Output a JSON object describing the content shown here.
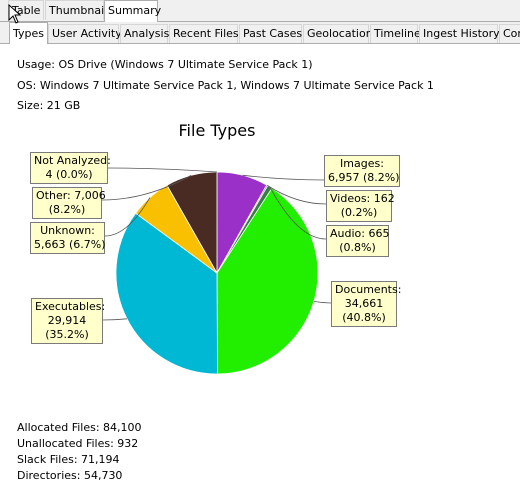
{
  "tabs_top": [
    "Table",
    "Thumbnail",
    "Summary"
  ],
  "tabs_sub": [
    "Types",
    "User Activity",
    "Analysis",
    "Recent Files",
    "Past Cases",
    "Geolocation",
    "Timeline",
    "Ingest History",
    "Cor"
  ],
  "info": {
    "usage": "Usage: OS Drive (Windows 7 Ultimate Service Pack 1)",
    "os": "OS: Windows 7 Ultimate Service Pack 1, Windows 7 Ultimate Service Pack 1",
    "size": "Size: 21 GB"
  },
  "chart_data": {
    "type": "pie",
    "title": "File Types",
    "slices": [
      {
        "name": "Images",
        "value": 6957,
        "percent": 8.2,
        "color": "#9b30c8",
        "label_line1": "Images:",
        "label_line2": "6,957 (8.2%)"
      },
      {
        "name": "Videos",
        "value": 162,
        "percent": 0.2,
        "color": "#1a2fbf",
        "label_line1": "Videos: 162",
        "label_line2": "(0.2%)"
      },
      {
        "name": "Audio",
        "value": 665,
        "percent": 0.8,
        "color": "#3a7d44",
        "label_line1": "Audio: 665",
        "label_line2": "(0.8%)"
      },
      {
        "name": "Documents",
        "value": 34661,
        "percent": 40.8,
        "color": "#22ee00",
        "label_line1": "Documents:",
        "label_line2": "34,661",
        "label_line3": "(40.8%)"
      },
      {
        "name": "Executables",
        "value": 29914,
        "percent": 35.2,
        "color": "#00b8d4",
        "label_line1": "Executables:",
        "label_line2": "29,914",
        "label_line3": "(35.2%)"
      },
      {
        "name": "Unknown",
        "value": 5663,
        "percent": 6.7,
        "color": "#f8c000",
        "label_line1": "Unknown:",
        "label_line2": "5,663 (6.7%)"
      },
      {
        "name": "Other",
        "value": 7006,
        "percent": 8.2,
        "color": "#4a2b24",
        "label_line1": "Other: 7,006",
        "label_line2": "(8.2%)"
      },
      {
        "name": "Not Analyzed",
        "value": 4,
        "percent": 0.0,
        "color": "#777777",
        "label_line1": "Not Analyzed:",
        "label_line2": "4 (0.0%)"
      }
    ]
  },
  "stats": {
    "allocated": "Allocated Files: 84,100",
    "unallocated": "Unallocated Files: 932",
    "slack": "Slack Files: 71,194",
    "directories": "Directories: 54,730"
  }
}
